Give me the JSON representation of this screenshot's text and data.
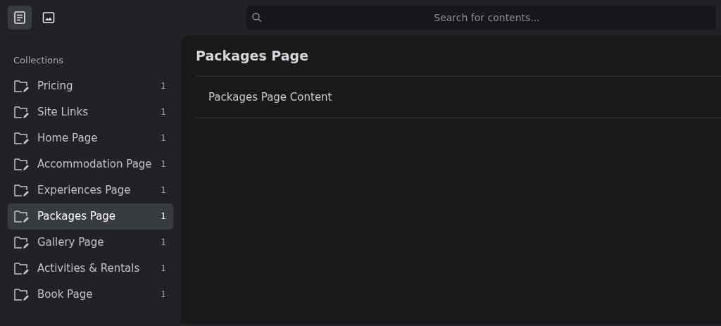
{
  "toolbar": [
    {
      "kind": "document",
      "selected": true
    },
    {
      "kind": "image",
      "selected": false
    }
  ],
  "search": {
    "placeholder": "Search for contents..."
  },
  "sidebar": {
    "heading": "Collections",
    "items": [
      {
        "label": "Pricing",
        "count": "1",
        "selected": false
      },
      {
        "label": "Site Links",
        "count": "1",
        "selected": false
      },
      {
        "label": "Home Page",
        "count": "1",
        "selected": false
      },
      {
        "label": "Accommodation Page",
        "count": "1",
        "selected": false
      },
      {
        "label": "Experiences Page",
        "count": "1",
        "selected": false
      },
      {
        "label": "Packages Page",
        "count": "1",
        "selected": true
      },
      {
        "label": "Gallery Page",
        "count": "1",
        "selected": false
      },
      {
        "label": "Activities & Rentals",
        "count": "1",
        "selected": false
      },
      {
        "label": "Book Page",
        "count": "1",
        "selected": false
      }
    ]
  },
  "main": {
    "title": "Packages Page",
    "rows": [
      {
        "label": "Packages Page Content"
      }
    ]
  }
}
